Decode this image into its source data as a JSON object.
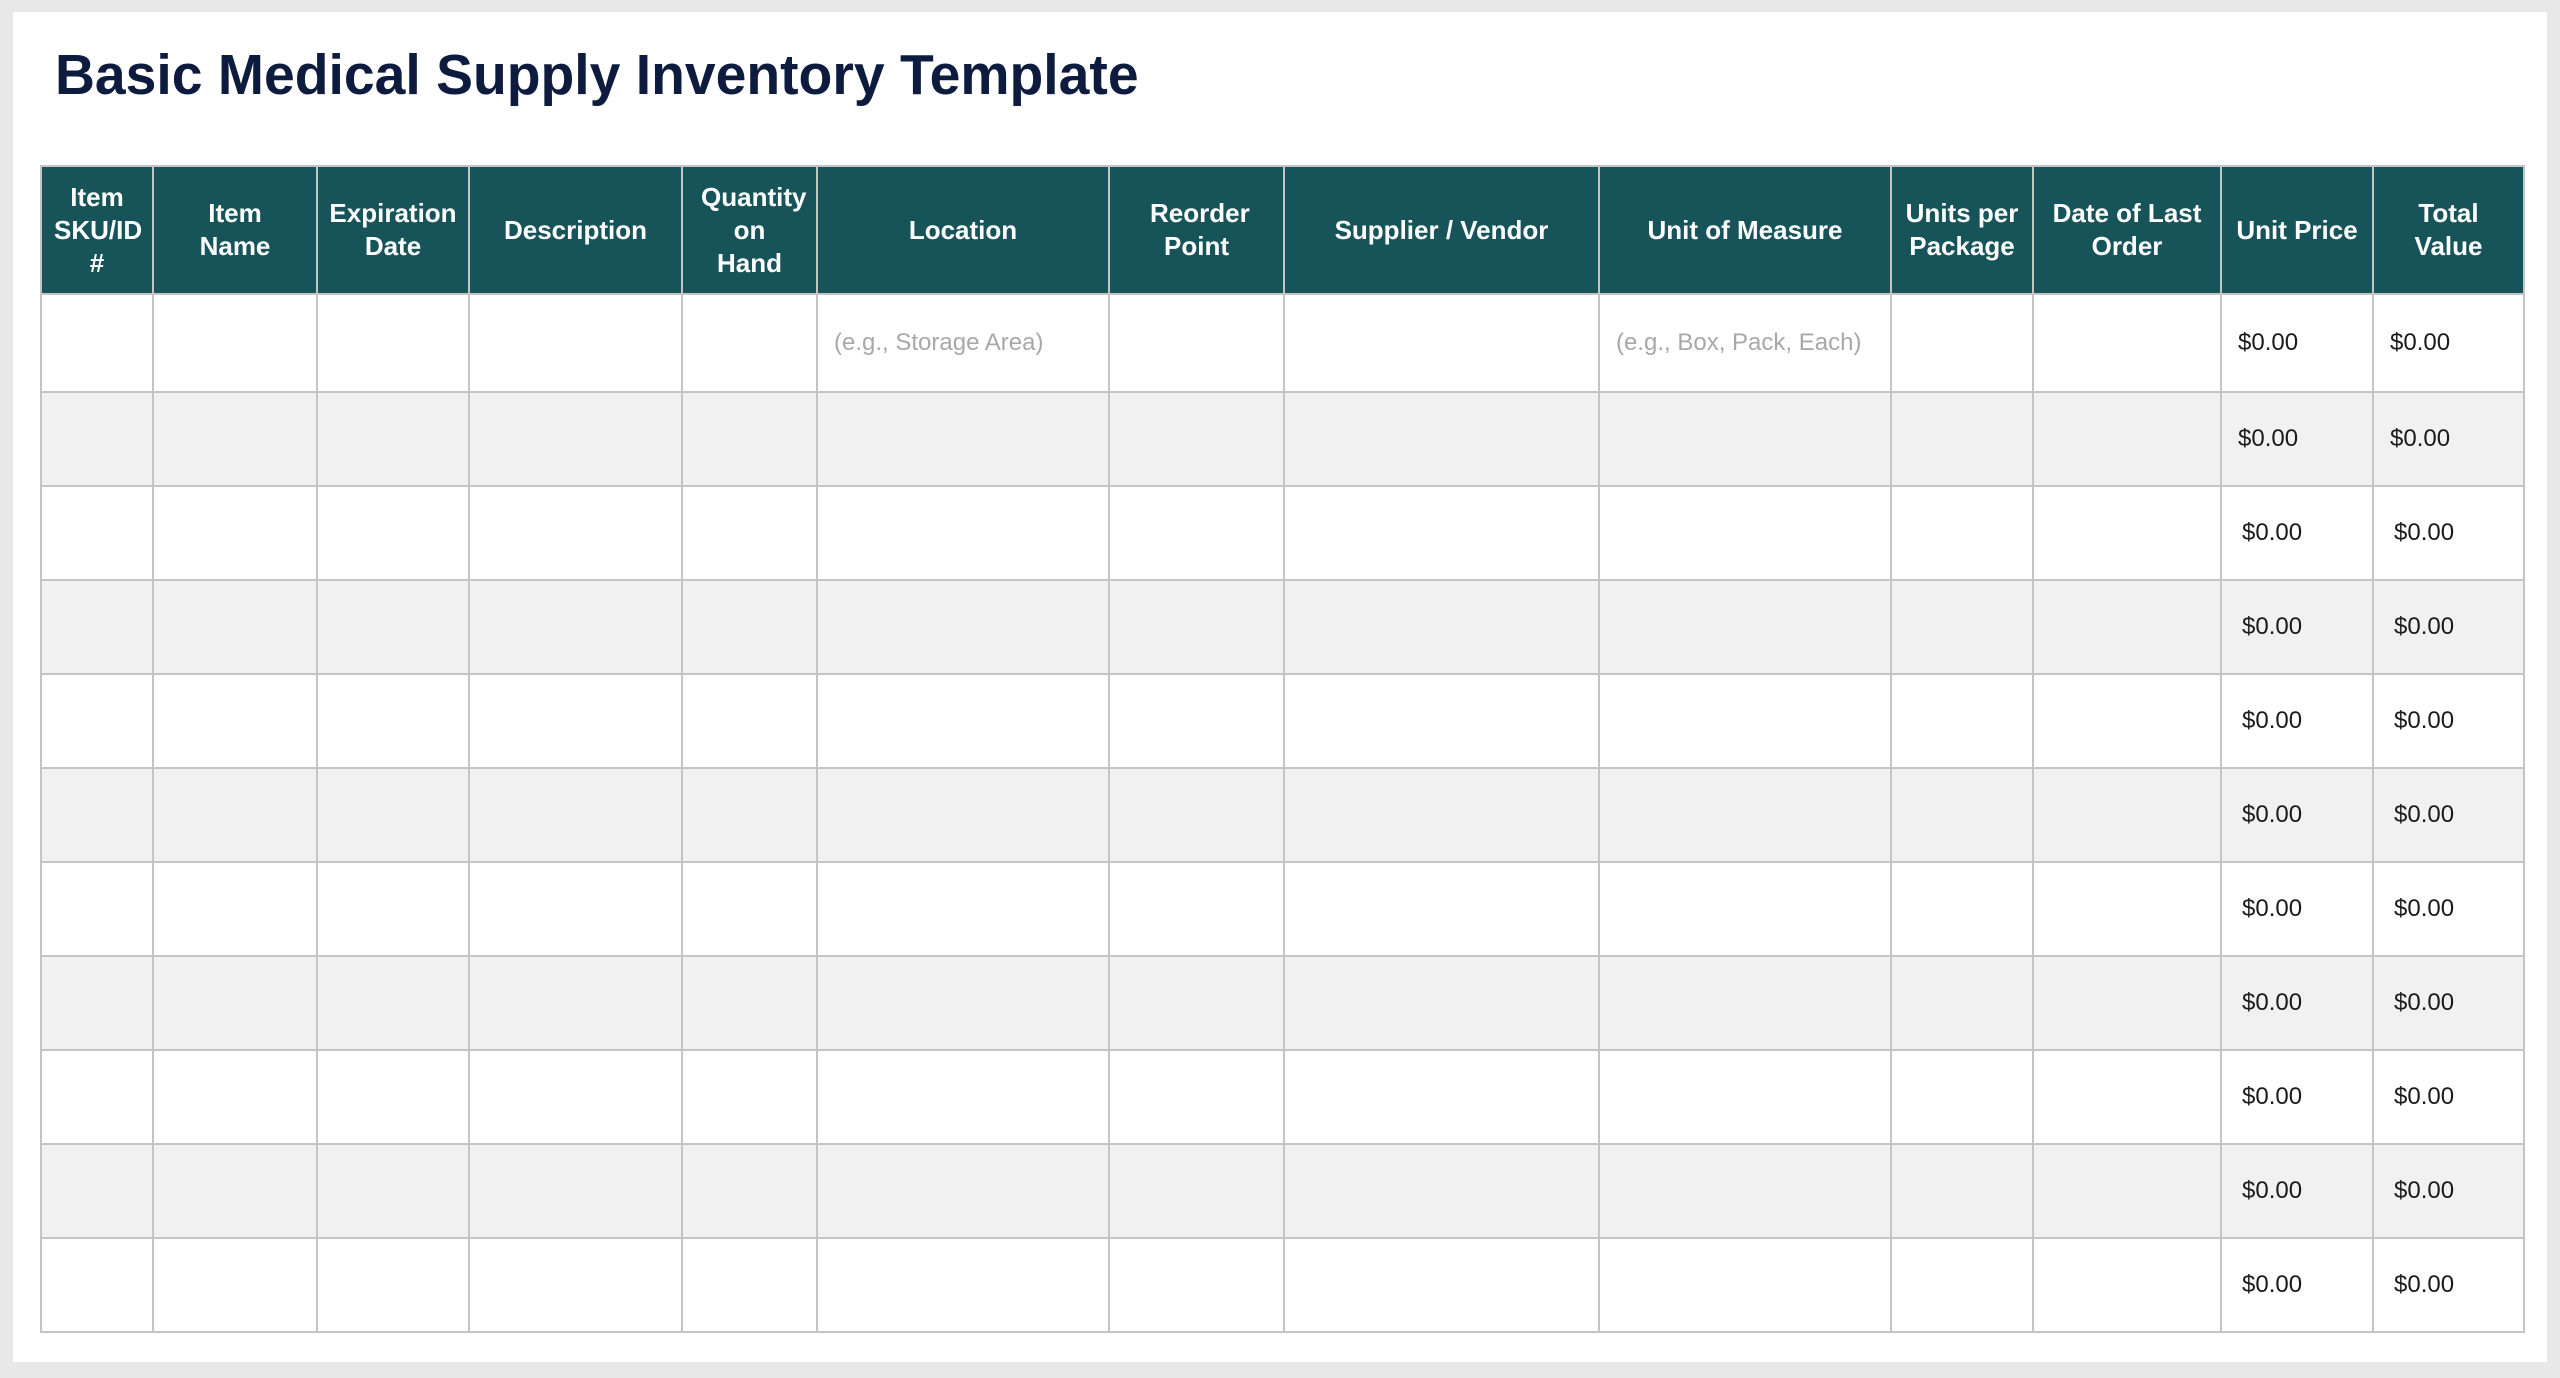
{
  "title": "Basic Medical Supply Inventory Template",
  "table": {
    "columns": [
      {
        "key": "sku",
        "label": "Item SKU/ID #"
      },
      {
        "key": "name",
        "label": "Item Name"
      },
      {
        "key": "expiration",
        "label": "Expiration Date"
      },
      {
        "key": "description",
        "label": "Description"
      },
      {
        "key": "quantity",
        "label": "Quantity on Hand"
      },
      {
        "key": "location",
        "label": "Location"
      },
      {
        "key": "reorder",
        "label": "Reorder Point"
      },
      {
        "key": "supplier",
        "label": "Supplier / Vendor"
      },
      {
        "key": "uom",
        "label": "Unit of Measure"
      },
      {
        "key": "units_per_package",
        "label": "Units per Package"
      },
      {
        "key": "last_order",
        "label": "Date of Last Order"
      },
      {
        "key": "unit_price",
        "label": "Unit Price"
      },
      {
        "key": "total_value",
        "label": "Total Value"
      }
    ],
    "placeholders": {
      "location": "(e.g., Storage Area)",
      "uom": "(e.g., Box, Pack, Each)"
    },
    "rows": [
      {
        "unit_price": "$0.00",
        "total_value": "$0.00"
      },
      {
        "unit_price": "$0.00",
        "total_value": "$0.00"
      },
      {
        "unit_price": "$0.00",
        "total_value": "$0.00"
      },
      {
        "unit_price": "$0.00",
        "total_value": "$0.00"
      },
      {
        "unit_price": "$0.00",
        "total_value": "$0.00"
      },
      {
        "unit_price": "$0.00",
        "total_value": "$0.00"
      },
      {
        "unit_price": "$0.00",
        "total_value": "$0.00"
      },
      {
        "unit_price": "$0.00",
        "total_value": "$0.00"
      },
      {
        "unit_price": "$0.00",
        "total_value": "$0.00"
      },
      {
        "unit_price": "$0.00",
        "total_value": "$0.00"
      },
      {
        "unit_price": "$0.00",
        "total_value": "$0.00"
      }
    ]
  },
  "colors": {
    "header_bg": "#17545a",
    "title": "#0d1b3e",
    "alt_row": "#f1f1f1"
  }
}
